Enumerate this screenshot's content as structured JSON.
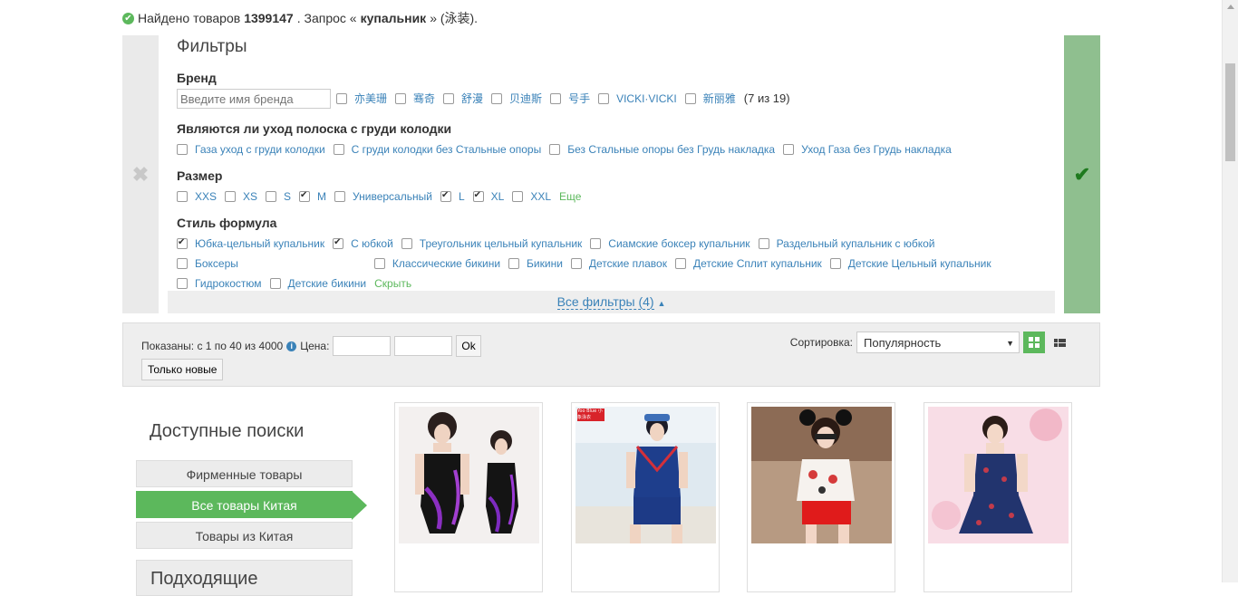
{
  "header": {
    "prefix": "Найдено товаров ",
    "count": "1399147",
    "mid": ". Запрос «",
    "query": "купальник",
    "suffix": "» (泳装)."
  },
  "filters": {
    "title": "Фильтры",
    "brand": {
      "title": "Бренд",
      "placeholder": "Введите имя бренда",
      "items": [
        "亦美珊",
        "骞奇",
        "舒漫",
        "贝迪斯",
        "号手",
        "VICKI·VICKI",
        "新丽雅"
      ],
      "count": "(7 из 19)"
    },
    "padding": {
      "title": "Являются ли уход полоска с груди колодки",
      "items": [
        "Газа уход с груди колодки",
        "С груди колодки без Стальные опоры",
        "Без Стальные опоры без Грудь накладка",
        "Уход Газа без Грудь накладка"
      ]
    },
    "size": {
      "title": "Размер",
      "items": [
        {
          "label": "XXS",
          "checked": false
        },
        {
          "label": "XS",
          "checked": false
        },
        {
          "label": "S",
          "checked": false
        },
        {
          "label": "M",
          "checked": true
        },
        {
          "label": "Универсальный",
          "checked": false
        },
        {
          "label": "L",
          "checked": true
        },
        {
          "label": "XL",
          "checked": true
        },
        {
          "label": "XXL",
          "checked": false
        }
      ],
      "more": "Еще"
    },
    "style": {
      "title": "Стиль формула",
      "items": [
        {
          "label": "Юбка-цельный купальник",
          "checked": true
        },
        {
          "label": "С юбкой",
          "checked": true
        },
        {
          "label": "Треугольник цельный купальник",
          "checked": false
        },
        {
          "label": "Сиамские боксер купальник",
          "checked": false
        },
        {
          "label": "Раздельный купальник с юбкой",
          "checked": false
        },
        {
          "label": "Боксеры",
          "checked": false
        },
        {
          "label": "Классические бикини",
          "checked": false
        },
        {
          "label": "Бикини",
          "checked": false
        },
        {
          "label": "Детские плавок",
          "checked": false
        },
        {
          "label": "Детские Сплит купальник",
          "checked": false
        },
        {
          "label": "Детские Цельный купальник",
          "checked": false
        },
        {
          "label": "Гидрокостюм",
          "checked": false
        },
        {
          "label": "Детские бикини",
          "checked": false
        }
      ],
      "hide": "Скрыть"
    },
    "all_filters": "Все фильтры (4)",
    "close_icon": "close-icon",
    "apply_icon": "checkmark-icon"
  },
  "toolbar": {
    "shown": "Показаны: с 1 по 40 из 4000",
    "price_label": "Цена:",
    "ok": "Ok",
    "new_only": "Только новые",
    "sort_label": "Сортировка:",
    "sort_value": "Популярность"
  },
  "sidebar": {
    "title": "Доступные поиски",
    "items": [
      {
        "label": "Фирменные товары",
        "active": false
      },
      {
        "label": "Все товары Китая",
        "active": true
      },
      {
        "label": "Товары из Китая",
        "active": false
      }
    ],
    "next_title": "Подходящие"
  },
  "products": [
    {
      "badge": ""
    },
    {
      "badge": "Yoo Blue 小象泳衣"
    },
    {
      "badge": ""
    },
    {
      "badge": ""
    }
  ],
  "colors": {
    "accent": "#5cb85c",
    "link": "#3a82b8"
  }
}
